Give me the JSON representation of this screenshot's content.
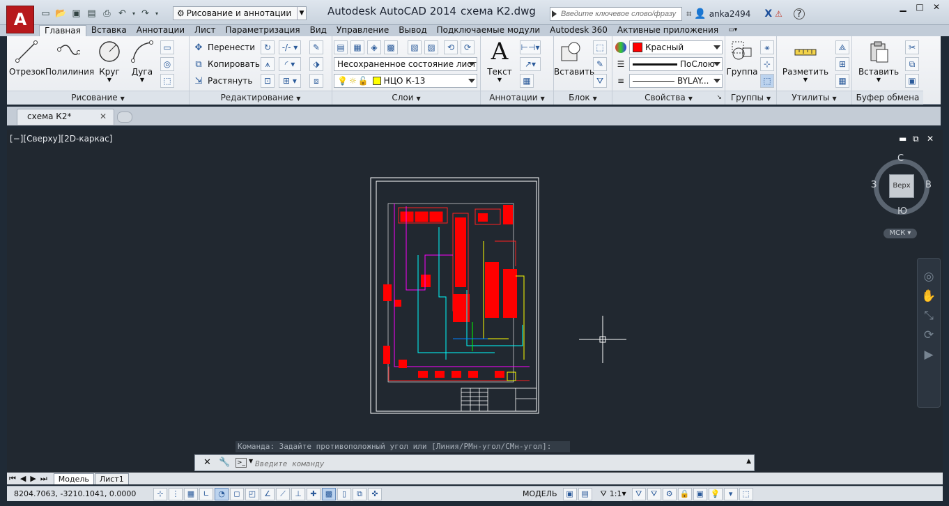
{
  "titlebar": {
    "workspace": "Рисование и аннотации",
    "app_title": "Autodesk AutoCAD 2014",
    "doc_title": "схема К2.dwg",
    "search_placeholder": "Введите ключевое слово/фразу",
    "user": "anka2494"
  },
  "ribbon_tabs": [
    "Главная",
    "Вставка",
    "Аннотации",
    "Лист",
    "Параметризация",
    "Вид",
    "Управление",
    "Вывод",
    "Подключаемые модули",
    "Autodesk 360",
    "Активные приложения"
  ],
  "panels": {
    "draw": {
      "title": "Рисование",
      "line": "Отрезок",
      "polyline": "Полилиния",
      "circle": "Круг",
      "arc": "Дуга"
    },
    "modify": {
      "title": "Редактирование",
      "move": "Перенести",
      "copy": "Копировать",
      "stretch": "Растянуть"
    },
    "layers": {
      "title": "Слои",
      "layer_state": "Несохраненное состояние листа",
      "current_layer": "НЦО К-13"
    },
    "annotation": {
      "title": "Аннотации",
      "text": "Текст"
    },
    "block": {
      "title": "Блок",
      "insert": "Вставить"
    },
    "properties": {
      "title": "Свойства",
      "color": "Красный",
      "lineweight": "ПоСлою",
      "linetype": "BYLAY..."
    },
    "groups": {
      "title": "Группы",
      "group": "Группа"
    },
    "utilities": {
      "title": "Утилиты",
      "measure": "Разметить"
    },
    "clipboard": {
      "title": "Буфер обмена",
      "paste": "Вставить"
    }
  },
  "file_tab": {
    "label": "схема К2*"
  },
  "viewport": {
    "label": "[−][Сверху][2D-каркас]",
    "viewcube": {
      "n": "С",
      "s": "Ю",
      "w": "З",
      "e": "В",
      "top": "Верх",
      "ucs": "МСК"
    }
  },
  "command": {
    "history": "Команда: Задайте противоположный угол или [Линия/РМн-угол/СМн-угол]:",
    "placeholder": "Введите команду"
  },
  "layout_tabs": [
    "Модель",
    "Лист1"
  ],
  "status": {
    "coords": "8204.7063, -3210.1041, 0.0000",
    "model": "МОДЕЛЬ",
    "scale": "1:1"
  },
  "colors": {
    "red": "#ff0000",
    "accent": "#2a5a9a",
    "canvas": "#212830"
  }
}
